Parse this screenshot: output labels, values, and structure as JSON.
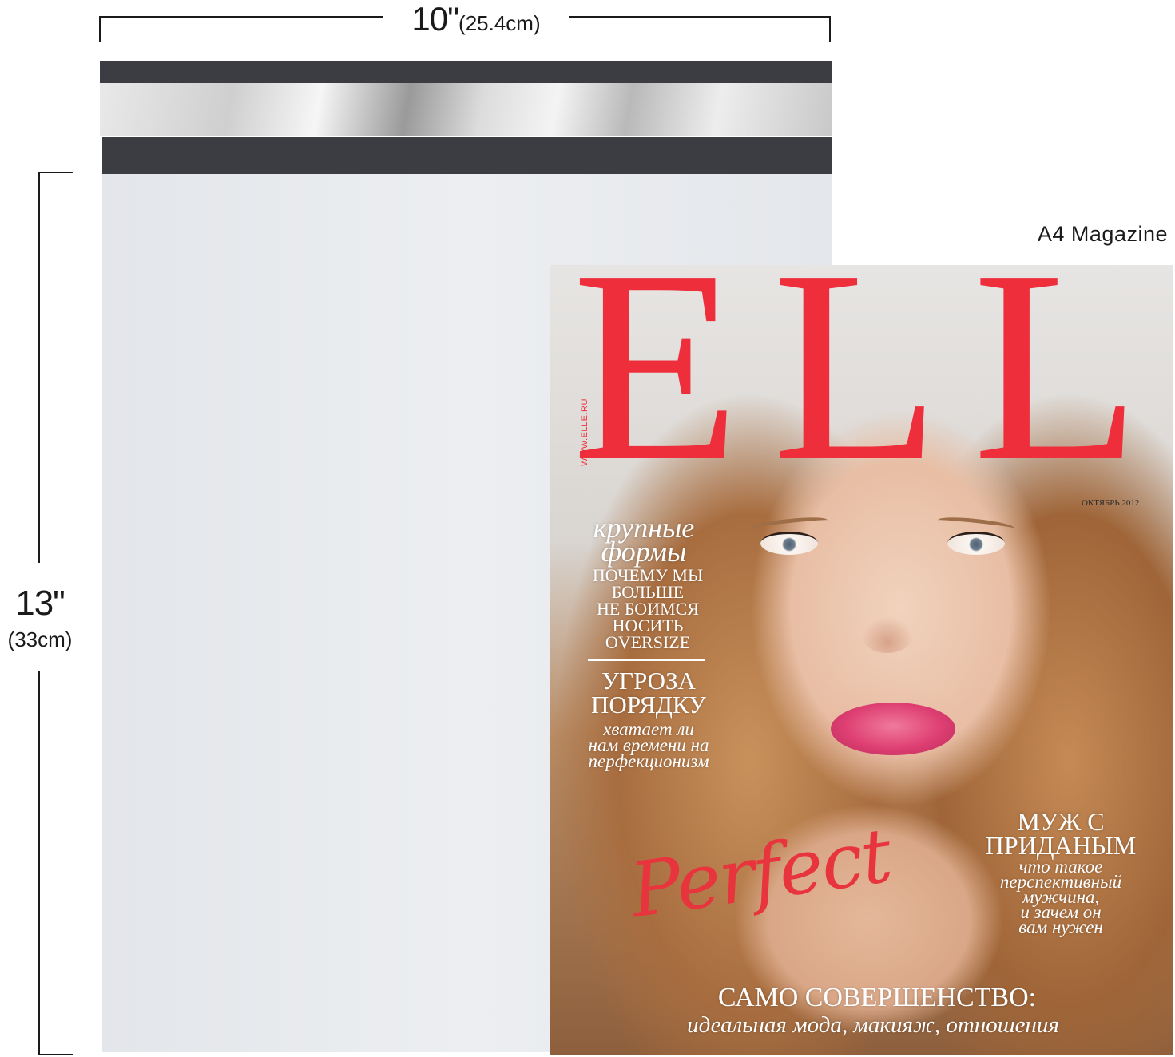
{
  "dimensions": {
    "width_value": "10\"",
    "width_metric": "(25.4cm)",
    "height_value": "13\"",
    "height_metric": "(33cm)"
  },
  "comparison_label": "A4 Magazine",
  "magazine": {
    "masthead": "ELLE",
    "website": "WWW.ELLE.RU",
    "issue_date": "ОКТЯБРЬ 2012",
    "headlines": {
      "h1_title_line1": "крупные",
      "h1_title_line2": "формы",
      "h1_body": [
        "ПОЧЕМУ МЫ",
        "БОЛЬШЕ",
        "НЕ БОИМСЯ",
        "НОСИТЬ",
        "OVERSIZE"
      ],
      "h2_title": [
        "УГРОЗА",
        "ПОРЯДКУ"
      ],
      "h2_body": [
        "хватает ли",
        "нам времени на",
        "перфекционизм"
      ],
      "h3_title": [
        "МУЖ С",
        "ПРИДАНЫМ"
      ],
      "h3_body": [
        "что такое",
        "перспективный",
        "мужчина,",
        "и зачем он",
        "вам нужен"
      ],
      "script_word": "Perfect",
      "main_title": "САМО СОВЕРШЕНСТВО:",
      "main_subtitle": "идеальная мода, макияж, отношения"
    }
  },
  "colors": {
    "masthead_red": "#ee2e3b",
    "mailer_body": "#e9ebee",
    "mailer_strip": "#3c3d42"
  }
}
